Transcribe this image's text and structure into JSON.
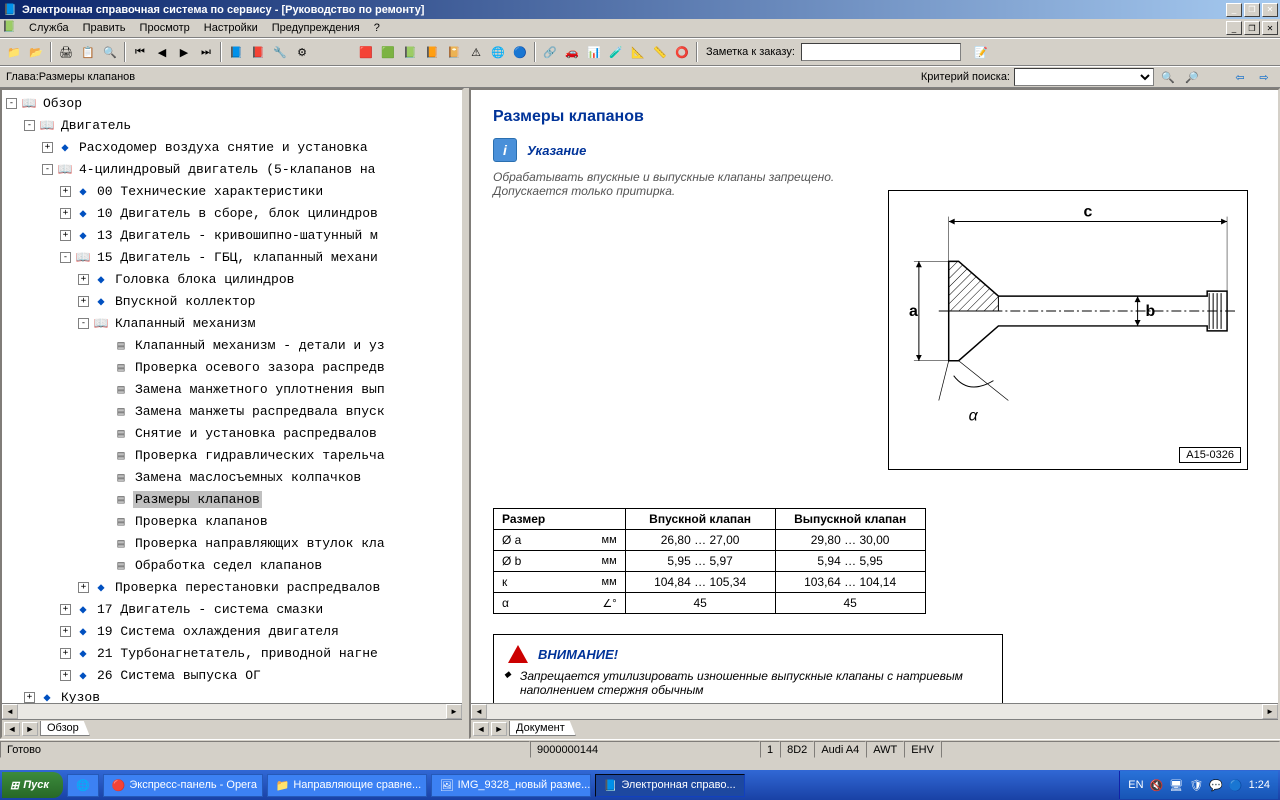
{
  "titlebar": {
    "text": "Электронная справочная система по сервису - [Руководство по ремонту]"
  },
  "menu": [
    "Служба",
    "Править",
    "Просмотр",
    "Настройки",
    "Предупреждения",
    "?"
  ],
  "toolbar": {
    "order_label": "Заметка к заказу:"
  },
  "inforow": {
    "chapter": "Глава:Размеры клапанов",
    "search_label": "Критерий  поиска:"
  },
  "tree": [
    {
      "indent": 0,
      "toggle": "-",
      "icon": "book",
      "label": "Обзор"
    },
    {
      "indent": 1,
      "toggle": "-",
      "icon": "book",
      "label": "Двигатель"
    },
    {
      "indent": 2,
      "toggle": "+",
      "icon": "diamond",
      "label": "Расходомер воздуха снятие и установка"
    },
    {
      "indent": 2,
      "toggle": "-",
      "icon": "book",
      "label": "4-цилиндровый двигатель (5-клапанов на"
    },
    {
      "indent": 3,
      "toggle": "+",
      "icon": "diamond",
      "label": "00 Технические характеристики"
    },
    {
      "indent": 3,
      "toggle": "+",
      "icon": "diamond",
      "label": "10 Двигатель в сборе, блок цилиндров"
    },
    {
      "indent": 3,
      "toggle": "+",
      "icon": "diamond",
      "label": "13 Двигатель - кривошипно-шатунный м"
    },
    {
      "indent": 3,
      "toggle": "-",
      "icon": "book",
      "label": "15 Двигатель - ГБЦ, клапанный механи"
    },
    {
      "indent": 4,
      "toggle": "+",
      "icon": "diamond",
      "label": "Головка блока цилиндров"
    },
    {
      "indent": 4,
      "toggle": "+",
      "icon": "diamond",
      "label": "Впускной коллектор"
    },
    {
      "indent": 4,
      "toggle": "-",
      "icon": "book",
      "label": "Клапанный механизм"
    },
    {
      "indent": 5,
      "toggle": "",
      "icon": "page",
      "label": "Клапанный механизм - детали и уз"
    },
    {
      "indent": 5,
      "toggle": "",
      "icon": "page",
      "label": "Проверка осевого зазора распредв"
    },
    {
      "indent": 5,
      "toggle": "",
      "icon": "page",
      "label": "Замена манжетного уплотнения вып"
    },
    {
      "indent": 5,
      "toggle": "",
      "icon": "page",
      "label": "Замена манжеты распредвала впуск"
    },
    {
      "indent": 5,
      "toggle": "",
      "icon": "page",
      "label": "Снятие и установка распредвалов"
    },
    {
      "indent": 5,
      "toggle": "",
      "icon": "page",
      "label": "Проверка гидравлических тарельча"
    },
    {
      "indent": 5,
      "toggle": "",
      "icon": "page",
      "label": "Замена маслосъемных колпачков"
    },
    {
      "indent": 5,
      "toggle": "",
      "icon": "page",
      "label": "Размеры клапанов",
      "selected": true
    },
    {
      "indent": 5,
      "toggle": "",
      "icon": "page",
      "label": "Проверка клапанов"
    },
    {
      "indent": 5,
      "toggle": "",
      "icon": "page",
      "label": "Проверка направляющих втулок кла"
    },
    {
      "indent": 5,
      "toggle": "",
      "icon": "page",
      "label": "Обработка седел клапанов"
    },
    {
      "indent": 4,
      "toggle": "+",
      "icon": "diamond",
      "label": "Проверка перестановки распредвалов"
    },
    {
      "indent": 3,
      "toggle": "+",
      "icon": "diamond",
      "label": "17 Двигатель - система смазки"
    },
    {
      "indent": 3,
      "toggle": "+",
      "icon": "diamond",
      "label": "19 Система охлаждения двигателя"
    },
    {
      "indent": 3,
      "toggle": "+",
      "icon": "diamond",
      "label": "21 Турбонагнетатель, приводной нагне"
    },
    {
      "indent": 3,
      "toggle": "+",
      "icon": "diamond",
      "label": "26 Система выпуска ОГ"
    },
    {
      "indent": 1,
      "toggle": "+",
      "icon": "diamond",
      "label": "Кузов"
    }
  ],
  "left_tab": "Обзор",
  "right_tab": "Документ",
  "doc": {
    "title": "Размеры клапанов",
    "note_label": "Указание",
    "note_text": "Обрабатывать впускные и выпускные клапаны запрещено. Допускается только притирка.",
    "fig_no": "A15-0326",
    "table": {
      "headers": [
        "Размер",
        "Впускной клапан",
        "Выпускной клапан"
      ],
      "rows": [
        {
          "dim": "Ø a",
          "unit": "мм",
          "in": "26,80 … 27,00",
          "ex": "29,80 … 30,00"
        },
        {
          "dim": "Ø b",
          "unit": "мм",
          "in": "5,95 … 5,97",
          "ex": "5,94 … 5,95"
        },
        {
          "dim": "к",
          "unit": "мм",
          "in": "104,84 … 105,34",
          "ex": "103,64 … 104,14"
        },
        {
          "dim": "α",
          "unit": "∠°",
          "in": "45",
          "ex": "45"
        }
      ]
    },
    "warn_label": "ВНИМАНИЕ!",
    "warn_text": "Запрещается утилизировать изношенные выпускные клапаны с натриевым наполнением стержня обычным"
  },
  "statusbar": {
    "ready": "Готово",
    "cells": [
      "9000000144",
      "1",
      "8D2",
      "Audi A4",
      "AWT",
      "EHV"
    ]
  },
  "taskbar": {
    "start": "Пуск",
    "items": [
      {
        "label": "Экспресс-панель - Opera",
        "icon": "🔴"
      },
      {
        "label": "Направляющие сравне...",
        "icon": "📁"
      },
      {
        "label": "IMG_9328_новый разме...",
        "icon": "🖼"
      },
      {
        "label": "Электронная справо...",
        "icon": "📘",
        "active": true
      }
    ],
    "lang": "EN",
    "clock": "1:24"
  },
  "diagram": {
    "a": "a",
    "b": "b",
    "c": "c",
    "alpha": "α"
  }
}
